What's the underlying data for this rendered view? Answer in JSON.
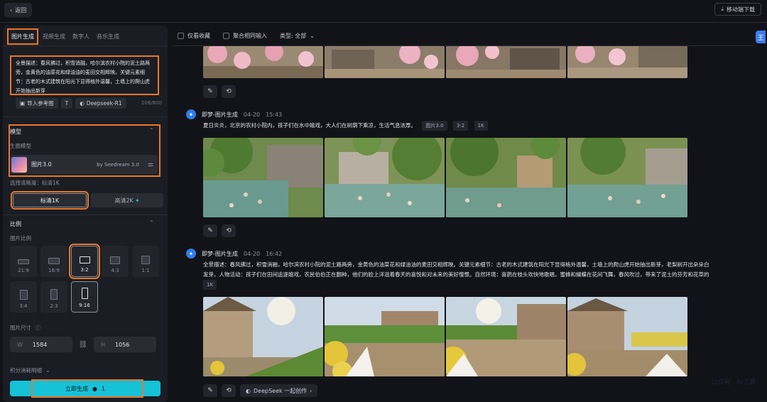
{
  "topbar": {
    "back_label": "返回",
    "download_label": "移动端下载"
  },
  "left_panel": {
    "tabs": [
      {
        "label": "图片生成",
        "active": true
      },
      {
        "label": "视频生成",
        "active": false
      },
      {
        "label": "数字人",
        "active": false
      },
      {
        "label": "音乐生成",
        "active": false
      }
    ],
    "prompt_text": "全景描述：春风拂过，积雪消融，哈尔滨农村小院的泥土路两旁，金黄色的油菜花和绿油油的麦田交相辉映。关键元素细节：古老的木式建筑在阳光下显得格外温馨，土墙上的爬山虎开始抽出新芽",
    "import_ref_label": "导入参考图",
    "deepseek_label": "Deepseek-R1",
    "char_count": "206/800",
    "model_section_title": "模型",
    "model_sub_label": "生图模型",
    "model_name": "图片3.0",
    "model_by": "by Seedream 3.0",
    "clarity_label": "选择清晰度：标清1K",
    "res_standard": "标清1K",
    "res_hd": "高清2K",
    "ratio_section_title": "比例",
    "ratio_sub_label": "图片比例",
    "ratios": [
      {
        "label": "21:9",
        "selected": false,
        "highlighted": false
      },
      {
        "label": "16:9",
        "selected": false,
        "highlighted": false
      },
      {
        "label": "3:2",
        "selected": true,
        "highlighted": true
      },
      {
        "label": "4:3",
        "selected": false,
        "highlighted": false
      },
      {
        "label": "1:1",
        "selected": false,
        "highlighted": false
      },
      {
        "label": "3:4",
        "selected": false,
        "highlighted": false
      },
      {
        "label": "2:3",
        "selected": false,
        "highlighted": false
      },
      {
        "label": "9:16",
        "selected": true,
        "highlighted": false
      }
    ],
    "size_label": "图片尺寸",
    "width_label": "W",
    "width_value": "1584",
    "height_label": "H",
    "height_value": "1056",
    "points_label": "积分消耗明细",
    "generate_label": "立即生成",
    "generate_cost": "1"
  },
  "filters": {
    "favorites_label": "仅看收藏",
    "merge_label": "聚合相同输入",
    "type_label": "类型: 全部"
  },
  "ai_badge_letter": "王",
  "entries": [
    {
      "name": "即梦-图片生成",
      "date": "04-20",
      "time": "15:43",
      "prompt": "夏日炎炎，北京的农村小院内，孩子们在水中嬉戏，大人们在树荫下乘凉，生活气息浓厚。",
      "tags": [
        "图片3.0",
        "3:2",
        "1K"
      ]
    },
    {
      "name": "即梦-图片生成",
      "date": "04-20",
      "time": "16:42",
      "prompt_line1": "全景描述：春风拂过，积雪消融，哈尔滨农村小院的泥土路两旁，金黄色的油菜花和绿油油的麦田交相辉映。关键元素细节：古老的木式建筑在阳光下显得格外温馨，土墙上的爬山虎开始抽出新芽，老梨树开出朵朵白",
      "prompt_line2": "发芽。人物活动：孩子们在田间追逐嬉戏，农民伯伯正在翻种，他们的脸上洋溢着春天的喜悦和对未来的美好憧憬。自然环境：喜鹊在枝头欢快地歌唱，蜜蜂和蝴蝶在花间飞舞，春风吹过，带来了泥土的芬芳和花草的",
      "tags": [
        "1K"
      ],
      "deepseek_label": "DeepSeek 一起创作"
    }
  ],
  "watermark": "公众号 · AI工具"
}
